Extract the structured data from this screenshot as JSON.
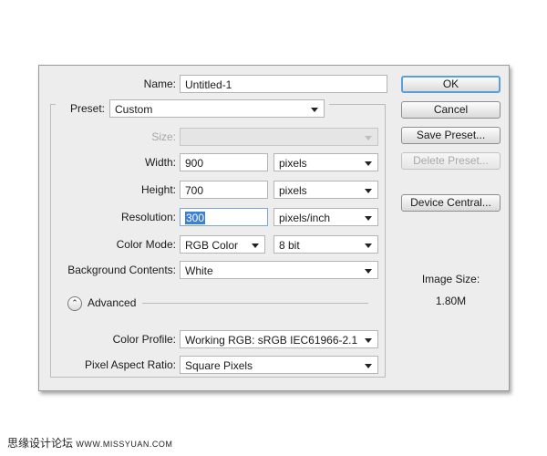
{
  "dialog": {
    "name_label": "Name:",
    "name_value": "Untitled-1",
    "preset_label": "Preset:",
    "preset_value": "Custom",
    "size_label": "Size:",
    "size_value": "",
    "width_label": "Width:",
    "width_value": "900",
    "width_unit": "pixels",
    "height_label": "Height:",
    "height_value": "700",
    "height_unit": "pixels",
    "resolution_label": "Resolution:",
    "resolution_value": "300",
    "resolution_unit": "pixels/inch",
    "color_mode_label": "Color Mode:",
    "color_mode_value": "RGB Color",
    "bit_depth_value": "8 bit",
    "background_label": "Background Contents:",
    "background_value": "White",
    "advanced_label": "Advanced",
    "color_profile_label": "Color Profile:",
    "color_profile_value": "Working RGB:  sRGB IEC61966-2.1",
    "pixel_aspect_label": "Pixel Aspect Ratio:",
    "pixel_aspect_value": "Square Pixels"
  },
  "buttons": {
    "ok": "OK",
    "cancel": "Cancel",
    "save_preset": "Save Preset...",
    "delete_preset": "Delete Preset...",
    "device_central": "Device Central..."
  },
  "image_size": {
    "label": "Image Size:",
    "value": "1.80M"
  },
  "watermark": {
    "chinese": "思缘设计论坛",
    "url": "WWW.MISSYUAN.COM"
  },
  "colors": {
    "dialog_bg": "#ededed",
    "ok_border": "#5b9fd8",
    "selection": "#3c7fd6"
  }
}
